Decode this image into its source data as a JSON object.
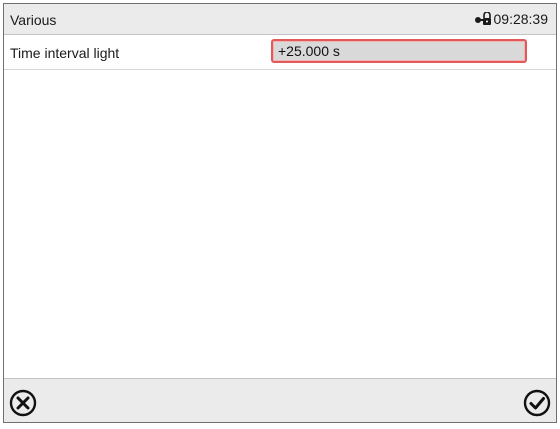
{
  "header": {
    "title": "Various",
    "time": "09:28:39",
    "status_icon": "lock-icon"
  },
  "settings": {
    "rows": [
      {
        "label": "Time interval light",
        "value": "+25.000 s"
      }
    ]
  },
  "footer": {
    "cancel_icon": "cancel-circle-icon",
    "confirm_icon": "confirm-check-circle-icon"
  },
  "colors": {
    "header_bg": "#ebebeb",
    "field_bg": "#d9d9d9",
    "field_border": "#e05a5a"
  }
}
